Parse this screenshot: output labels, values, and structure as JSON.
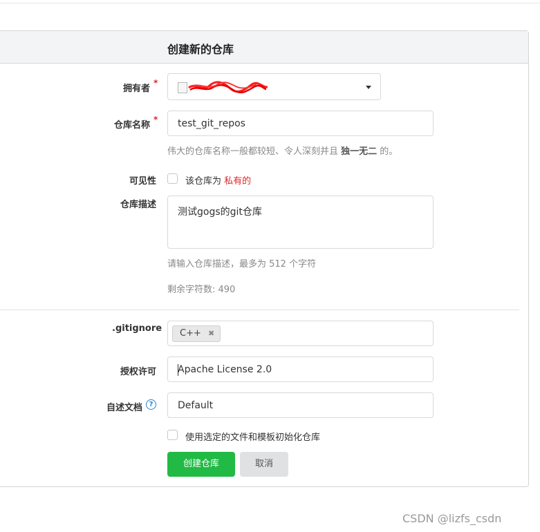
{
  "title": "创建新的仓库",
  "owner": {
    "label": "拥有者",
    "required_mark": "*",
    "dropdown_icon": "caret-down-icon"
  },
  "repo_name": {
    "label": "仓库名称",
    "required_mark": "*",
    "value": "test_git_repos"
  },
  "repo_name_help": {
    "part1": "伟大的仓库名称一般都较短、令人深刻并且 ",
    "emph": "独一无二",
    "part2": " 的。"
  },
  "visibility": {
    "label": "可见性",
    "text": "该仓库为 ",
    "private": "私有的"
  },
  "description": {
    "label": "仓库描述",
    "value": "测试gogs的git仓库",
    "help": "请输入仓库描述，最多为 512 个字符",
    "remaining": "剩余字符数: 490"
  },
  "gitignore": {
    "label": ".gitignore",
    "tag": "C++",
    "remove_icon": "close-icon"
  },
  "license": {
    "label": "授权许可",
    "value": "Apache License 2.0"
  },
  "readme": {
    "label": "自述文档",
    "help_icon": "question-circle-icon",
    "value": "Default"
  },
  "auto_init": {
    "label": "使用选定的文件和模板初始化仓库"
  },
  "buttons": {
    "create": "创建仓库",
    "cancel": "取消"
  },
  "watermark": "CSDN @lizfs_csdn",
  "colors": {
    "primary": "#21ba45",
    "private": "#db2828",
    "header_bg": "#f3f4f5"
  }
}
